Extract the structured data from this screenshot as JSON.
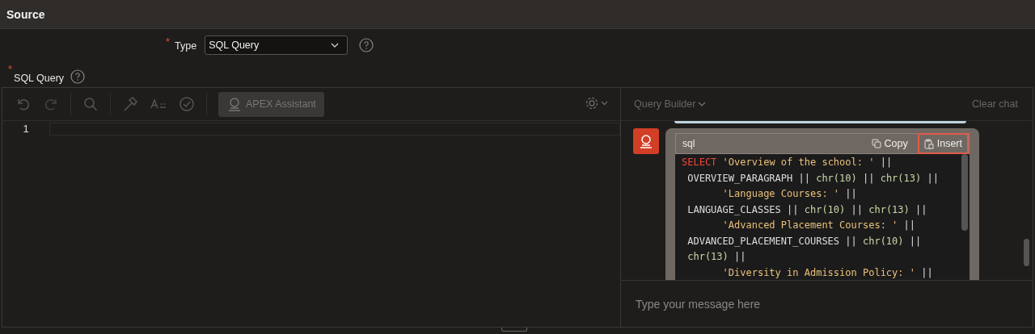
{
  "header": {
    "title": "Source"
  },
  "type_field": {
    "required_mark": "*",
    "label": "Type",
    "value": "SQL Query"
  },
  "sql_label": {
    "required_mark": "*",
    "label": "SQL Query"
  },
  "toolbar": {
    "assistant_button": "APEX Assistant",
    "assistant_active": true
  },
  "editor": {
    "line_numbers": [
      "1"
    ]
  },
  "chat": {
    "query_builder": "Query Builder",
    "clear": "Clear chat",
    "code_block": {
      "language": "sql",
      "copy": "Copy",
      "insert": "Insert",
      "insert_focused": true,
      "lines": [
        [
          {
            "kind": "keyword",
            "text": "SELECT"
          },
          {
            "kind": "string",
            "text": " 'Overview of the school: '"
          },
          {
            "kind": "plain",
            "text": " ||"
          }
        ],
        [
          {
            "kind": "plain",
            "text": " OVERVIEW_PARAGRAPH || "
          },
          {
            "kind": "func",
            "text": "chr(10)"
          },
          {
            "kind": "plain",
            "text": " || "
          },
          {
            "kind": "func",
            "text": "chr(13)"
          },
          {
            "kind": "plain",
            "text": " ||"
          }
        ],
        [
          {
            "kind": "string",
            "text": "       'Language Courses: '"
          },
          {
            "kind": "plain",
            "text": " ||"
          }
        ],
        [
          {
            "kind": "plain",
            "text": " LANGUAGE_CLASSES || "
          },
          {
            "kind": "func",
            "text": "chr(10)"
          },
          {
            "kind": "plain",
            "text": " || "
          },
          {
            "kind": "func",
            "text": "chr(13)"
          },
          {
            "kind": "plain",
            "text": " ||"
          }
        ],
        [
          {
            "kind": "string",
            "text": "       'Advanced Placement Courses: '"
          },
          {
            "kind": "plain",
            "text": " ||"
          }
        ],
        [
          {
            "kind": "plain",
            "text": " ADVANCED_PLACEMENT_COURSES || "
          },
          {
            "kind": "func",
            "text": "chr(10)"
          },
          {
            "kind": "plain",
            "text": " ||"
          }
        ],
        [
          {
            "kind": "func",
            "text": " chr(13)"
          },
          {
            "kind": "plain",
            "text": " ||"
          }
        ],
        [
          {
            "kind": "string",
            "text": "       'Diversity in Admission Policy: '"
          },
          {
            "kind": "plain",
            "text": " ||"
          }
        ]
      ]
    },
    "input": {
      "placeholder": "Type your message here"
    }
  }
}
